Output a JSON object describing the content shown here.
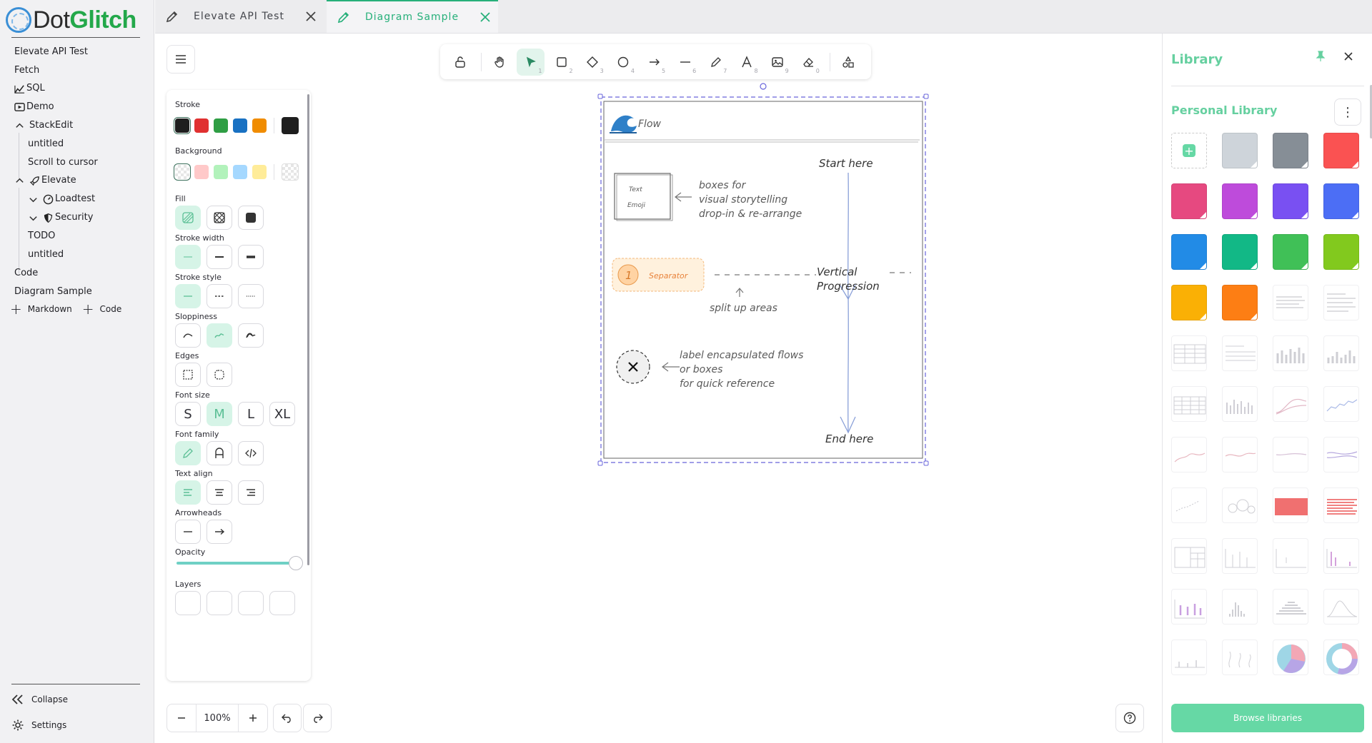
{
  "brand": {
    "prefix": "Dot",
    "accent": "Glitch"
  },
  "nav": {
    "items": [
      {
        "label": "Elevate API Test"
      },
      {
        "label": "Fetch"
      },
      {
        "label": "SQL"
      },
      {
        "label": "Demo"
      },
      {
        "label": "StackEdit"
      },
      {
        "label": "untitled"
      },
      {
        "label": "Scroll to cursor"
      },
      {
        "label": "Elevate"
      },
      {
        "label": "Loadtest"
      },
      {
        "label": "Security"
      },
      {
        "label": "TODO"
      },
      {
        "label": "untitled"
      },
      {
        "label": "Code"
      },
      {
        "label": "Diagram Sample"
      }
    ],
    "add_markdown": "Markdown",
    "add_code": "Code",
    "collapse": "Collapse",
    "settings": "Settings"
  },
  "tabs": [
    {
      "label": "Elevate API Test"
    },
    {
      "label": "Diagram Sample"
    }
  ],
  "toolbar": {
    "keys": [
      "1",
      "2",
      "3",
      "4",
      "5",
      "6",
      "7",
      "8",
      "9",
      "0"
    ]
  },
  "props": {
    "stroke": "Stroke",
    "background": "Background",
    "fill": "Fill",
    "stroke_width": "Stroke width",
    "stroke_style": "Stroke style",
    "sloppiness": "Sloppiness",
    "edges": "Edges",
    "font_size": "Font size",
    "font_sizes": [
      "S",
      "M",
      "L",
      "XL"
    ],
    "font_family": "Font family",
    "text_align": "Text align",
    "arrowheads": "Arrowheads",
    "opacity": "Opacity",
    "opacity_value": 1.0,
    "layers": "Layers",
    "stroke_colors": [
      "#1e1e1e",
      "#e03131",
      "#2f9e44",
      "#1971c2",
      "#f08c00"
    ],
    "stroke_current": "#1e1e1e",
    "bg_colors": [
      "transparent",
      "#ffc9c9",
      "#b2f2bb",
      "#a5d8ff",
      "#ffec99"
    ]
  },
  "zoom": {
    "value": "100%"
  },
  "drawing": {
    "title": "Flow",
    "start": "Start here",
    "box_text_1": "Text",
    "box_text_2": "Emoji",
    "boxes_line1": "boxes for",
    "boxes_line2": "visual storytelling",
    "boxes_line3": "drop-in & re-arrange",
    "sep_num": "1",
    "sep_label": "Separator",
    "vertical_1": "Vertical",
    "vertical_2": "Progression",
    "split": "split up areas",
    "label_1": "label encapsulated flows",
    "label_2": "or boxes",
    "label_3": "for quick reference",
    "end": "End here"
  },
  "library": {
    "title": "Library",
    "personal": "Personal Library",
    "browse": "Browse libraries",
    "sticky_colors": [
      "#ced4da",
      "#868e96",
      "#fa5252",
      "#e64980",
      "#be4bdb",
      "#7950f2",
      "#4c6ef5",
      "#228be6",
      "#12b886",
      "#40c057",
      "#82c91e",
      "#fab005",
      "#fd7e14"
    ]
  }
}
